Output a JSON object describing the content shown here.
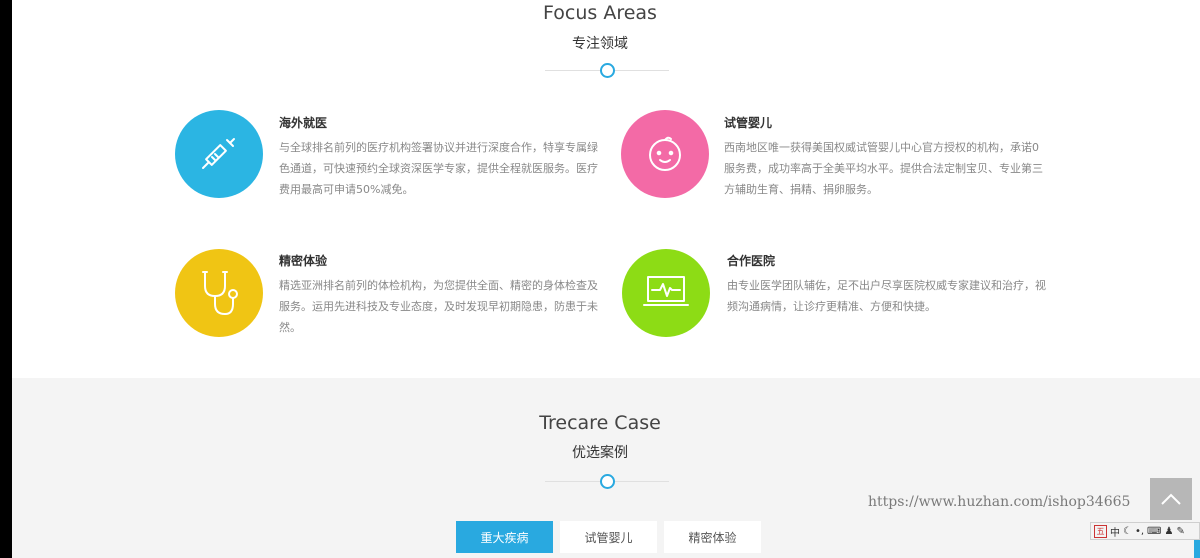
{
  "focus": {
    "title": "Focus Areas",
    "subtitle": "专注领域"
  },
  "features": [
    {
      "title": "海外就医",
      "desc": "与全球排名前列的医疗机构签署协议并进行深度合作，特享专属绿色通道，可快速预约全球资深医学专家，提供全程就医服务。医疗费用最高可申请50%减免。",
      "color": "#2bb5e3",
      "icon": "syringe-icon"
    },
    {
      "title": "试管婴儿",
      "desc": "西南地区唯一获得美国权威试管婴儿中心官方授权的机构，承诺0服务费，成功率高于全美平均水平。提供合法定制宝贝、专业第三方辅助生育、捐精、捐卵服务。",
      "color": "#f36aa6",
      "icon": "baby-face-icon"
    },
    {
      "title": "精密体验",
      "desc": "精选亚洲排名前列的体检机构，为您提供全面、精密的身体检查及服务。运用先进科技及专业态度，及时发现早初期隐患，防患于未然。",
      "color": "#f0c514",
      "icon": "stethoscope-icon"
    },
    {
      "title": "合作医院",
      "desc": "由专业医学团队辅佐，足不出户尽享医院权威专家建议和治疗，视频沟通病情，让诊疗更精准、方便和快捷。",
      "color": "#8ddc15",
      "icon": "monitor-pulse-icon"
    }
  ],
  "cases": {
    "title": "Trecare Case",
    "subtitle": "优选案例",
    "tabs": [
      {
        "label": "重大疾病",
        "active": true
      },
      {
        "label": "试管婴儿",
        "active": false
      },
      {
        "label": "精密体验",
        "active": false
      }
    ]
  },
  "watermark": "https://www.huzhan.com/ishop34665",
  "ime": {
    "lang": "中",
    "mode_icon": "moon-icon",
    "items": [
      "•,",
      "keyboard-icon",
      "person-icon",
      "wrench-icon"
    ]
  },
  "accent_color": "#29a9e0"
}
